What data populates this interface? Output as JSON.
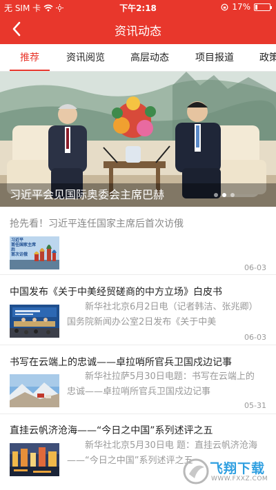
{
  "status_bar": {
    "carrier": "无 SIM 卡",
    "time": "下午2:18",
    "battery": "17%",
    "battery_level": 0.17
  },
  "header": {
    "title": "资讯动态"
  },
  "tabs": [
    {
      "label": "推荐",
      "active": true
    },
    {
      "label": "资讯阅览",
      "active": false
    },
    {
      "label": "高层动态",
      "active": false
    },
    {
      "label": "项目报道",
      "active": false
    },
    {
      "label": "政策",
      "active": false
    }
  ],
  "banner": {
    "caption": "习近平会见国际奥委会主席巴赫",
    "slide_count": 3,
    "active_slide": 1
  },
  "news": [
    {
      "title": "抢先看！习近平连任国家主席后首次访俄",
      "thumb_text": "习近平\n首任国家主席后\n首次访俄",
      "date": "06-03"
    },
    {
      "title": "中国发布《关于中美经贸磋商的中方立场》白皮书",
      "summary_line1": "新华社北京6月2日电（记者韩洁、张兆卿）",
      "summary_line2": "国务院新闻办公室2日发布《关于中美",
      "date": "06-03"
    },
    {
      "title": "书写在云端上的忠诚——卓拉哨所官兵卫国戍边记事",
      "summary_line1": "新华社拉萨5月30日电题：书写在云端上的",
      "summary_line2": "忠诚——卓拉哨所官兵卫国戍边记事",
      "date": "05-31"
    },
    {
      "title": "直挂云帆济沧海——“今日之中国”系列述评之五",
      "summary_line1": "新华社北京5月30日电 题：直挂云帆济沧海",
      "summary_line2": "——“今日之中国”系列述评之五"
    }
  ],
  "watermark": {
    "text": "飞翔下载",
    "url": "WWW.FXXZ.COM"
  },
  "colors": {
    "brand_red": "#e8372c"
  }
}
